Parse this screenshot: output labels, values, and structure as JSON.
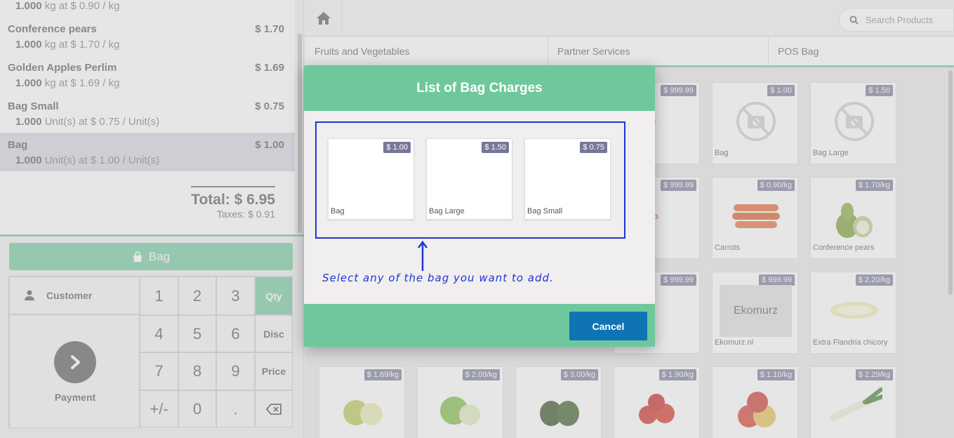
{
  "order": {
    "lines": [
      {
        "name": "",
        "price": "",
        "qty": "1.000",
        "info": "kg at $ 0.90 / kg"
      },
      {
        "name": "Conference pears",
        "price": "$ 1.70",
        "qty": "1.000",
        "info": "kg at $ 1.70 / kg"
      },
      {
        "name": "Golden Apples Perlim",
        "price": "$ 1.69",
        "qty": "1.000",
        "info": "kg at $ 1.69 / kg"
      },
      {
        "name": "Bag Small",
        "price": "$ 0.75",
        "qty": "1.000",
        "info": "Unit(s) at $ 0.75 / Unit(s)"
      },
      {
        "name": "Bag",
        "price": "$ 1.00",
        "qty": "1.000",
        "info": "Unit(s) at $ 1.00 / Unit(s)"
      }
    ],
    "total": "Total: $ 6.95",
    "taxes": "Taxes: $ 0.91"
  },
  "bag_button": {
    "label": "Bag",
    "icon": "shopping-bag-icon"
  },
  "numpad": {
    "customer_label": "Customer",
    "payment_label": "Payment",
    "keys": [
      "1",
      "2",
      "3",
      "4",
      "5",
      "6",
      "7",
      "8",
      "9",
      "+/-",
      "0",
      "."
    ],
    "modes": {
      "qty": "Qty",
      "disc": "Disc",
      "price": "Price"
    },
    "backspace_icon": "backspace-icon",
    "active_mode": "Qty"
  },
  "topbar": {
    "home_icon": "home-icon",
    "search_placeholder": "Search Products"
  },
  "categories": [
    "Fruits and Vegetables",
    "Partner Services",
    "POS Bag"
  ],
  "products": [
    {
      "name": "",
      "price": "$ 999.99"
    },
    {
      "name": "Bag",
      "price": "$ 1.00"
    },
    {
      "name": "Bag Large",
      "price": "$ 1.50"
    },
    {
      "name": "",
      "price": "$ 999.99"
    },
    {
      "name": "Carrots",
      "price": "$ 0.90/kg"
    },
    {
      "name": "Conference pears",
      "price": "$ 1.70/kg"
    },
    {
      "name": "",
      "price": "$ 999.99"
    },
    {
      "name": "Ekomurz.nl",
      "price": "$ 999.99"
    },
    {
      "name": "Extra Flandria chicory",
      "price": "$ 2.20/kg"
    },
    {
      "name": "",
      "price": "$ 1.69/kg"
    },
    {
      "name": "",
      "price": "$ 2.09/kg"
    },
    {
      "name": "",
      "price": "$ 3.00/kg"
    },
    {
      "name": "",
      "price": "$ 1.90/kg"
    },
    {
      "name": "",
      "price": "$ 1.10/kg"
    },
    {
      "name": "",
      "price": "$ 2.29/kg"
    }
  ],
  "modal": {
    "title": "List of Bag Charges",
    "bags": [
      {
        "name": "Bag",
        "price": "$ 1.00"
      },
      {
        "name": "Bag Large",
        "price": "$ 1.50"
      },
      {
        "name": "Bag Small",
        "price": "$ 0.75"
      }
    ],
    "hint": "Select any of the bag you want to add.",
    "cancel_label": "Cancel"
  },
  "colors": {
    "accent": "#6ec89b",
    "cancel": "#0e74b3",
    "annotation": "#1f36d4",
    "price_tag": "#77779a"
  }
}
